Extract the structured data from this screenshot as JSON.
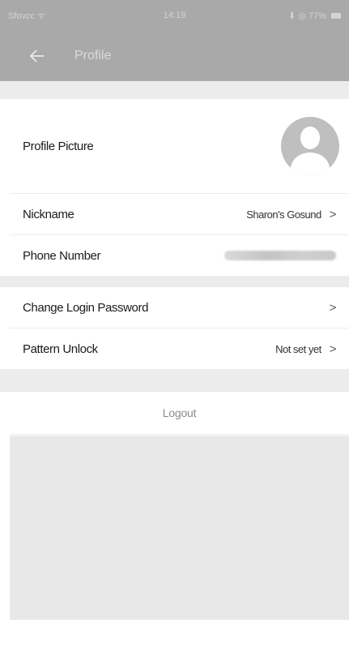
{
  "status_bar": {
    "carrier": "Sfovcc ᯤ",
    "time": "14:19",
    "battery": "⬇ ◎ 77% "
  },
  "nav": {
    "title": "Profile"
  },
  "profile": {
    "picture_label": "Profile Picture",
    "nickname_label": "Nickname",
    "nickname_value": "Sharon's Gosund",
    "phone_label": "Phone Number"
  },
  "security": {
    "password_label": "Change Login Password",
    "pattern_label": "Pattern Unlock",
    "pattern_value": "Not set yet"
  },
  "logout_label": "Logout",
  "icons": {
    "back": "arrow-left-icon",
    "chevron": "chevron-right-icon",
    "avatar": "user-avatar-icon"
  },
  "chevron_glyph": ">"
}
